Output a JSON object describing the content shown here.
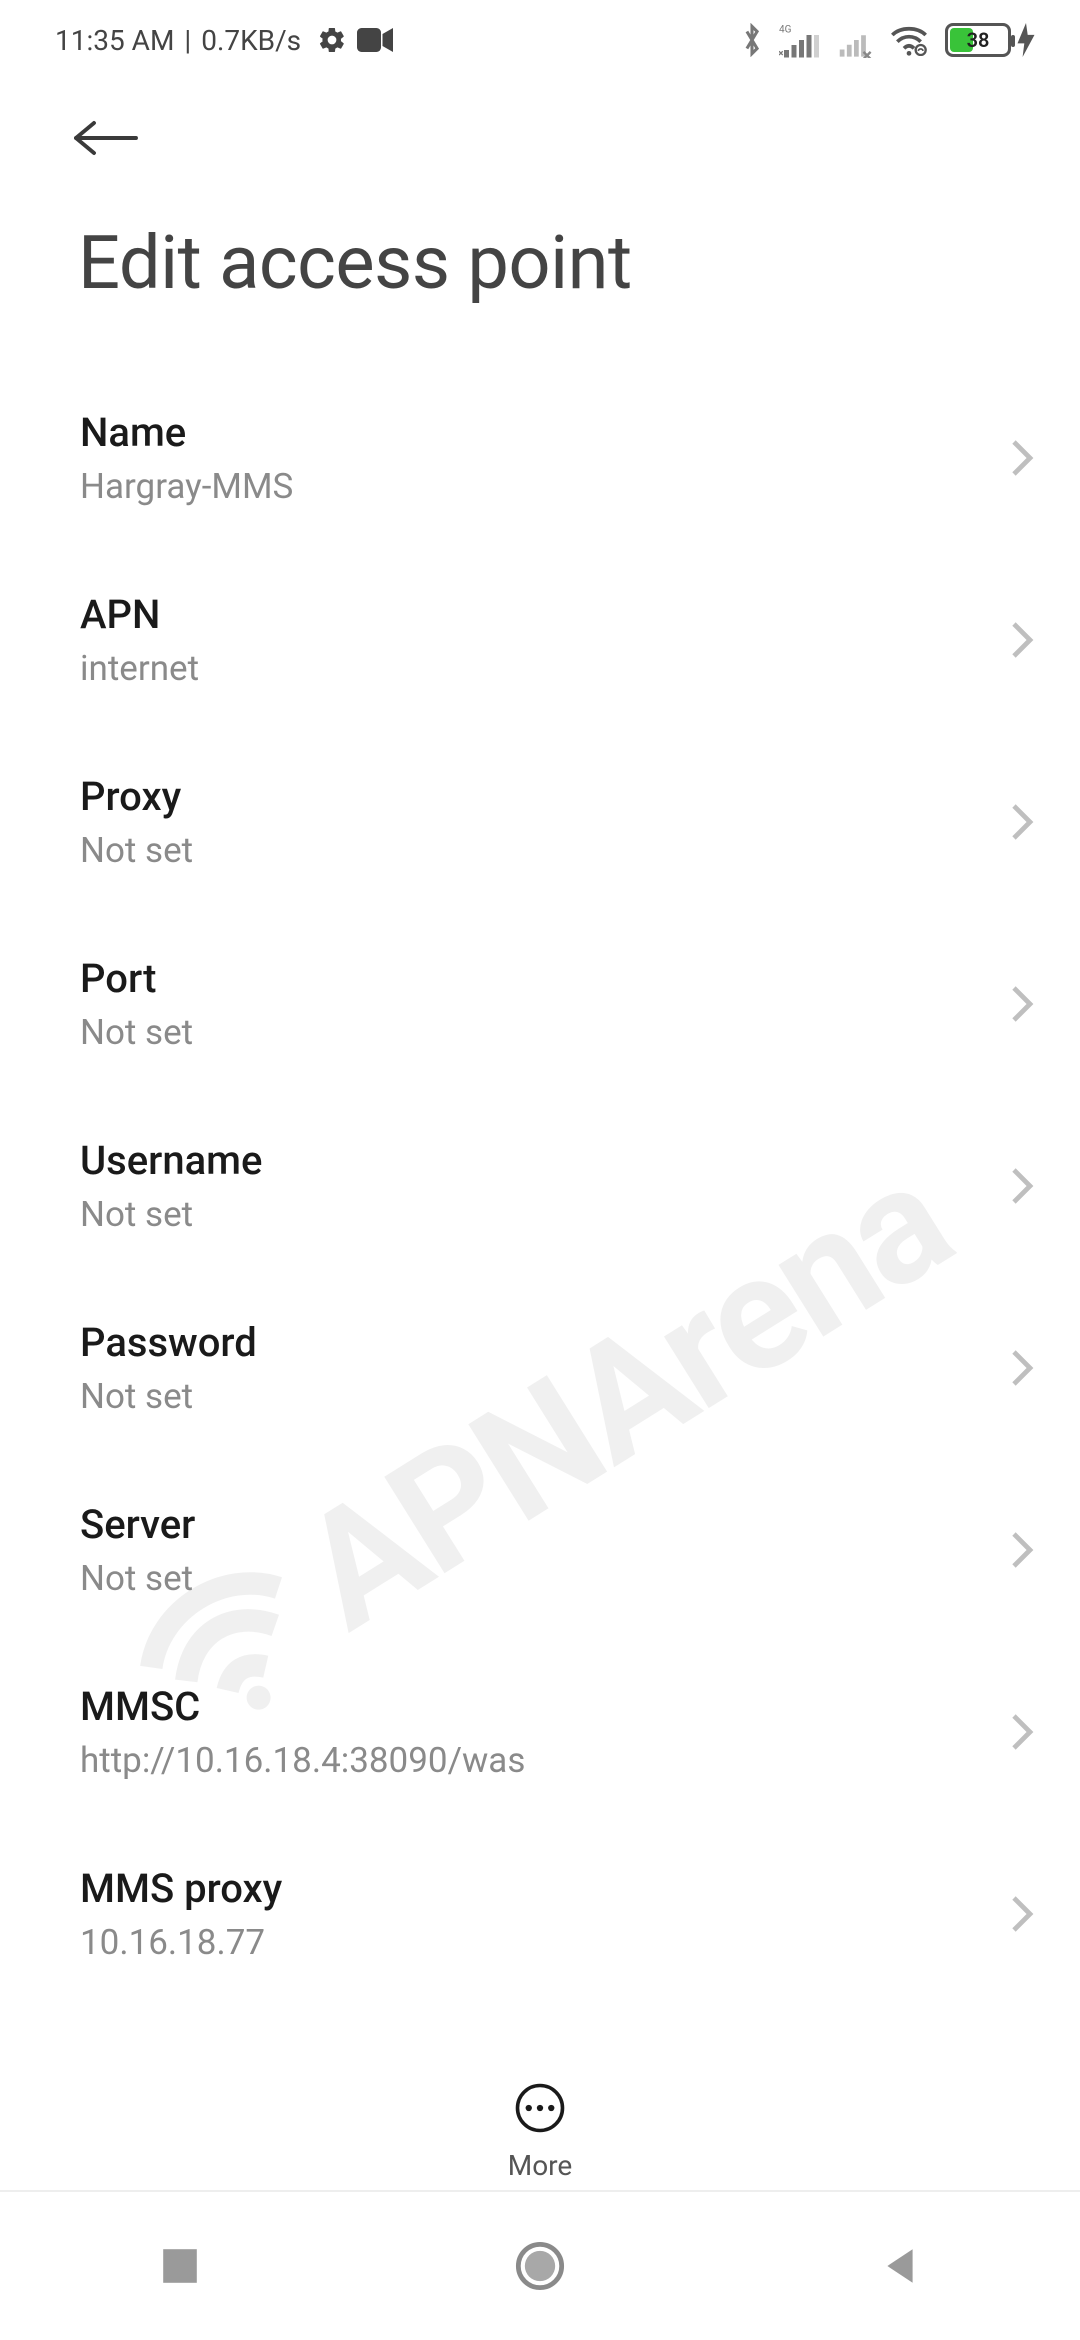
{
  "status": {
    "time": "11:35 AM",
    "separator": " | ",
    "data_rate": "0.7KB/s",
    "icons": {
      "settings": "gear-icon",
      "camera": "camera-icon",
      "bluetooth": "bluetooth-icon",
      "signal1_label": "4G",
      "signal2_label": "x",
      "wifi": "wifi-icon"
    },
    "battery_percent": "38",
    "charging": true
  },
  "header": {
    "back": "back",
    "title": "Edit access point"
  },
  "watermark": "APNArena",
  "settings": [
    {
      "label": "Name",
      "value": "Hargray-MMS"
    },
    {
      "label": "APN",
      "value": "internet"
    },
    {
      "label": "Proxy",
      "value": "Not set"
    },
    {
      "label": "Port",
      "value": "Not set"
    },
    {
      "label": "Username",
      "value": "Not set"
    },
    {
      "label": "Password",
      "value": "Not set"
    },
    {
      "label": "Server",
      "value": "Not set"
    },
    {
      "label": "MMSC",
      "value": "http://10.16.18.4:38090/was"
    },
    {
      "label": "MMS proxy",
      "value": "10.16.18.77"
    }
  ],
  "footer": {
    "more": "More"
  }
}
